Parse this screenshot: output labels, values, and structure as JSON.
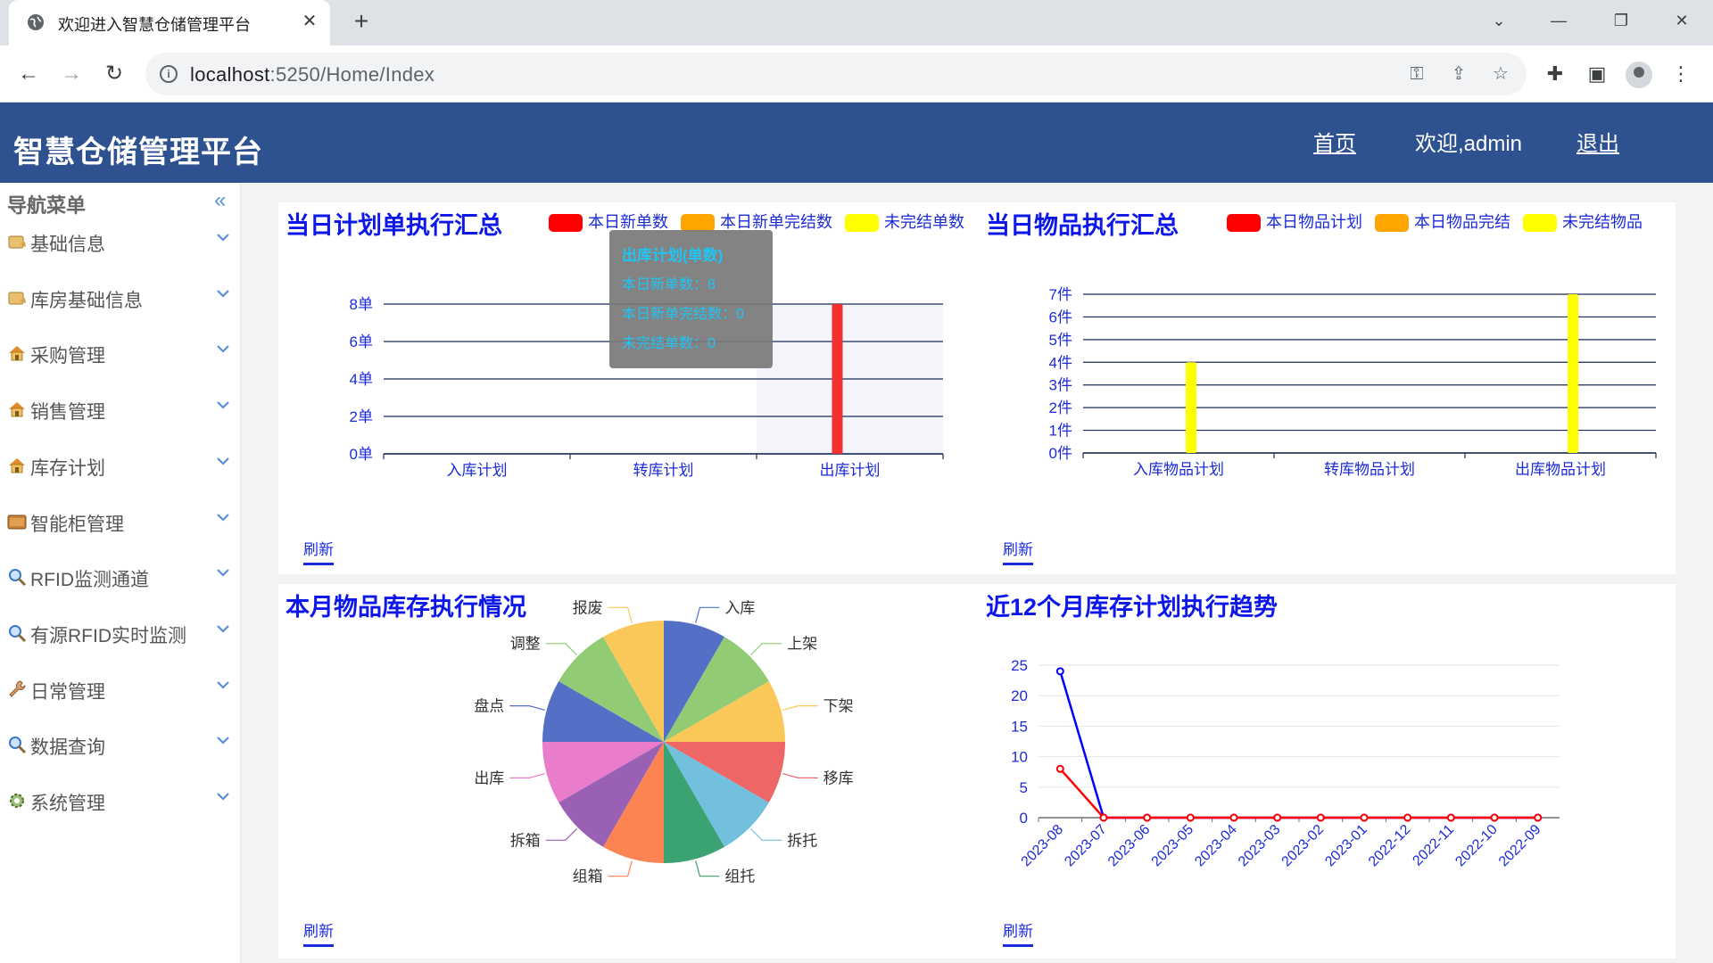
{
  "browser": {
    "tab_title": "欢迎进入智慧仓储管理平台",
    "url_host": "localhost",
    "url_path": ":5250/Home/Index"
  },
  "header": {
    "title": "智慧仓储管理平台",
    "home_link": "首页",
    "welcome": "欢迎,admin",
    "logout_link": "退出"
  },
  "sidebar": {
    "title": "导航菜单",
    "items": [
      {
        "label": "基础信息",
        "icon": "box-icon"
      },
      {
        "label": "库房基础信息",
        "icon": "box-icon"
      },
      {
        "label": "采购管理",
        "icon": "house-icon"
      },
      {
        "label": "销售管理",
        "icon": "house-icon"
      },
      {
        "label": "库存计划",
        "icon": "house-icon"
      },
      {
        "label": "智能柜管理",
        "icon": "cabinet-icon"
      },
      {
        "label": "RFID监测通道",
        "icon": "search-icon"
      },
      {
        "label": "有源RFID实时监测",
        "icon": "search-icon"
      },
      {
        "label": "日常管理",
        "icon": "wrench-icon"
      },
      {
        "label": "数据查询",
        "icon": "search-icon"
      },
      {
        "label": "系统管理",
        "icon": "gear-icon"
      }
    ]
  },
  "panels": {
    "plan_summary": {
      "title": "当日计划单执行汇总",
      "refresh": "刷新",
      "tooltip": {
        "title": "出库计划(单数)",
        "rows": [
          "本日新单数：8",
          "本日新单完结数：0",
          "未完结单数：0"
        ]
      }
    },
    "item_summary": {
      "title": "当日物品执行汇总",
      "refresh": "刷新"
    },
    "monthly_stock": {
      "title": "本月物品库存执行情况",
      "refresh": "刷新"
    },
    "trend": {
      "title": "近12个月库存计划执行趋势",
      "refresh": "刷新"
    }
  },
  "chart_data": [
    {
      "type": "bar",
      "categories": [
        "入库计划",
        "转库计划",
        "出库计划"
      ],
      "series": [
        {
          "name": "本日新单数",
          "color": "#ff0000",
          "values": [
            0,
            0,
            8
          ]
        },
        {
          "name": "本日新单完结数",
          "color": "#ffa500",
          "values": [
            0,
            0,
            0
          ]
        },
        {
          "name": "未完结单数",
          "color": "#ffff00",
          "values": [
            0,
            0,
            0
          ]
        }
      ],
      "yticks": [
        "0单",
        "2单",
        "4单",
        "6单",
        "8单"
      ],
      "ylim": [
        0,
        8
      ],
      "highlight_category": 2
    },
    {
      "type": "bar",
      "categories": [
        "入库物品计划",
        "转库物品计划",
        "出库物品计划"
      ],
      "series": [
        {
          "name": "本日物品计划",
          "color": "#ff0000",
          "values": [
            0,
            0,
            0
          ]
        },
        {
          "name": "本日物品完结",
          "color": "#ffa500",
          "values": [
            0,
            0,
            0
          ]
        },
        {
          "name": "未完结物品",
          "color": "#ffff00",
          "values": [
            4,
            0,
            7
          ]
        }
      ],
      "yticks": [
        "0件",
        "1件",
        "2件",
        "3件",
        "4件",
        "5件",
        "6件",
        "7件"
      ],
      "ylim": [
        0,
        7
      ]
    },
    {
      "type": "pie",
      "slices": [
        {
          "label": "入库",
          "value": 1,
          "color": "#5470c6"
        },
        {
          "label": "上架",
          "value": 1,
          "color": "#91cc75"
        },
        {
          "label": "下架",
          "value": 1,
          "color": "#fac858"
        },
        {
          "label": "移库",
          "value": 1,
          "color": "#ee6666"
        },
        {
          "label": "拆托",
          "value": 1,
          "color": "#73c0de"
        },
        {
          "label": "组托",
          "value": 1,
          "color": "#3ba272"
        },
        {
          "label": "组箱",
          "value": 1,
          "color": "#fc8452"
        },
        {
          "label": "拆箱",
          "value": 1,
          "color": "#9a60b4"
        },
        {
          "label": "出库",
          "value": 1,
          "color": "#ea7ccc"
        },
        {
          "label": "盘点",
          "value": 1,
          "color": "#5470c6"
        },
        {
          "label": "调整",
          "value": 1,
          "color": "#91cc75"
        },
        {
          "label": "报废",
          "value": 1,
          "color": "#fac858"
        }
      ]
    },
    {
      "type": "line",
      "x": [
        "2023-08",
        "2023-07",
        "2023-06",
        "2023-05",
        "2023-04",
        "2023-03",
        "2023-02",
        "2023-01",
        "2022-12",
        "2022-11",
        "2022-10",
        "2022-09"
      ],
      "series": [
        {
          "color": "#0000ff",
          "values": [
            24,
            0,
            0,
            0,
            0,
            0,
            0,
            0,
            0,
            0,
            0,
            0
          ]
        },
        {
          "color": "#ff0000",
          "values": [
            8,
            0,
            0,
            0,
            0,
            0,
            0,
            0,
            0,
            0,
            0,
            0
          ]
        }
      ],
      "yticks": [
        "0",
        "5",
        "10",
        "15",
        "20",
        "25"
      ],
      "ylim": [
        0,
        25
      ]
    }
  ]
}
